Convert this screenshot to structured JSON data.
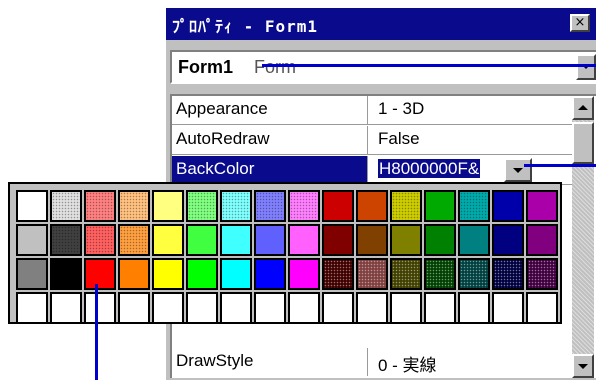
{
  "window": {
    "title": "ﾌﾟﾛﾊﾟﾃｨ - Form1",
    "close_label": "×"
  },
  "object_combo": {
    "name": "Form1",
    "type": "Form"
  },
  "properties": [
    {
      "name": "Appearance",
      "value": "1 - 3D",
      "selected": false
    },
    {
      "name": "AutoRedraw",
      "value": "False",
      "selected": false
    },
    {
      "name": "BackColor",
      "value": "H8000000F&",
      "selected": true
    },
    {
      "name": "DrawStyle",
      "value": "0 - 実線",
      "selected": false
    }
  ],
  "palette": {
    "rows": [
      [
        "#ffffff",
        "#e0e0e0",
        "#ff8080",
        "#ffc080",
        "#ffff80",
        "#80ff80",
        "#80ffff",
        "#8080ff",
        "#ff80ff",
        "#cc0000",
        "#cc4400",
        "#cccc00",
        "#00aa00",
        "#00aaaa",
        "#0000aa",
        "#aa00aa"
      ],
      [
        "#c0c0c0",
        "#404040",
        "#ff6060",
        "#ffa040",
        "#ffff40",
        "#40ff40",
        "#40ffff",
        "#6060ff",
        "#ff60ff",
        "#800000",
        "#804000",
        "#808000",
        "#008000",
        "#008080",
        "#000080",
        "#800080"
      ],
      [
        "#808080",
        "#000000",
        "#ff0000",
        "#ff8000",
        "#ffff00",
        "#00ff00",
        "#00ffff",
        "#0000ff",
        "#ff00ff",
        "#400000",
        "#804040",
        "#404000",
        "#004000",
        "#004040",
        "#000040",
        "#400040"
      ],
      [
        "#ffffff",
        "#ffffff",
        "#ffffff",
        "#ffffff",
        "#ffffff",
        "#ffffff",
        "#ffffff",
        "#ffffff",
        "#ffffff",
        "#ffffff",
        "#ffffff",
        "#ffffff",
        "#ffffff",
        "#ffffff",
        "#ffffff",
        "#ffffff"
      ]
    ],
    "dither": [
      [
        0,
        1,
        1,
        1,
        0,
        1,
        1,
        1,
        1,
        0,
        0,
        1,
        0,
        1,
        0,
        0
      ],
      [
        0,
        1,
        1,
        1,
        0,
        0,
        0,
        0,
        0,
        0,
        0,
        0,
        0,
        0,
        0,
        0
      ],
      [
        0,
        0,
        0,
        0,
        0,
        0,
        0,
        0,
        0,
        1,
        1,
        1,
        1,
        1,
        1,
        1
      ],
      [
        0,
        0,
        0,
        0,
        0,
        0,
        0,
        0,
        0,
        0,
        0,
        0,
        0,
        0,
        0,
        0
      ]
    ]
  },
  "colors": {
    "title_bar": "#0a0a8c",
    "selection": "#0a0a8c",
    "callout": "#0000cc",
    "window_face": "#c0c0c0"
  }
}
